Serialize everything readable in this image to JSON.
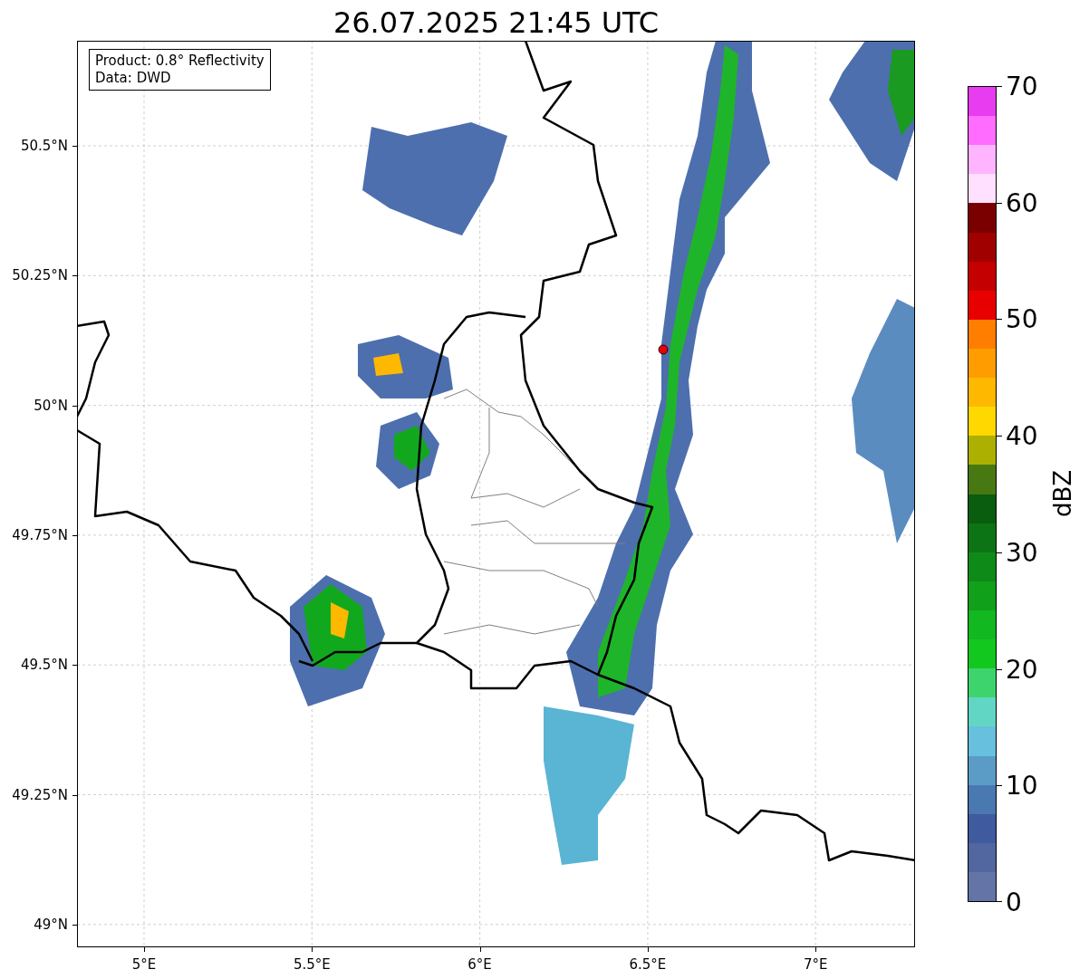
{
  "title": "26.07.2025 21:45 UTC",
  "info_box": [
    "Product: 0.8° Reflectivity",
    "Data: DWD"
  ],
  "axes": {
    "yticks": [
      "50.5°N",
      "50.25°N",
      "50°N",
      "49.75°N",
      "49.5°N",
      "49.25°N",
      "49°N"
    ],
    "xticks": [
      "5°E",
      "5.5°E",
      "6°E",
      "6.5°E",
      "7°E"
    ]
  },
  "colorbar": {
    "label": "dBZ",
    "ticks": [
      "70",
      "60",
      "50",
      "40",
      "30",
      "20",
      "10",
      "0"
    ],
    "segments": [
      {
        "color": "#e83cf0"
      },
      {
        "color": "#ff6cff"
      },
      {
        "color": "#ffb4ff"
      },
      {
        "color": "#ffe0ff"
      },
      {
        "color": "#7a0000"
      },
      {
        "color": "#a00000"
      },
      {
        "color": "#c40000"
      },
      {
        "color": "#e80000"
      },
      {
        "color": "#ff7e00"
      },
      {
        "color": "#ff9c00"
      },
      {
        "color": "#ffb800"
      },
      {
        "color": "#ffd800"
      },
      {
        "color": "#acb000"
      },
      {
        "color": "#487812"
      },
      {
        "color": "#0a5c0e"
      },
      {
        "color": "#0c7414"
      },
      {
        "color": "#0e8a18"
      },
      {
        "color": "#10a01a"
      },
      {
        "color": "#12b820"
      },
      {
        "color": "#12c81e"
      },
      {
        "color": "#3dd46e"
      },
      {
        "color": "#62d6c4"
      },
      {
        "color": "#66c0de"
      },
      {
        "color": "#5a9cc6"
      },
      {
        "color": "#4a78b0"
      },
      {
        "color": "#405aa0"
      },
      {
        "color": "#5266a0"
      },
      {
        "color": "#6474a6"
      }
    ]
  }
}
